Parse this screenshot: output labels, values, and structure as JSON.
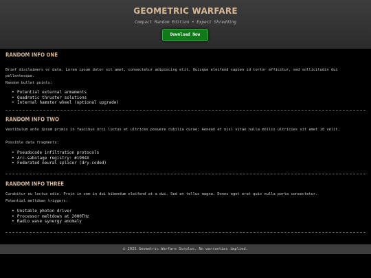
{
  "header": {
    "title": "GEOMETRIC WARFARE",
    "subtitle": "Compact Random Edition • Expect Shredding",
    "download_label": "Download Now"
  },
  "sections": [
    {
      "heading": "RANDOM INFO ONE",
      "body": "Brief disclaimers or data. Lorem ipsum dolor sit amet, consectetur adipiscing elit. Quisque eleifend sapien id tortor efficitur, sed sollicitudin dui pellentesque.",
      "caption": "Random bullet points:",
      "items": [
        "Potential external armaments",
        "Quadratic thruster solutions",
        "Internal hamster wheel (optional upgrade)"
      ]
    },
    {
      "heading": "RANDOM INFO TWO",
      "body": "Vestibulum ante ipsum primis in faucibus orci luctus et ultrices posuere cubilia curae; Aenean et nisl vitae nulla mollis ultricies sit amet id velit.",
      "caption": "Possible data fragments:",
      "items": [
        "Pseudocode infiltration protocols",
        "Arc-sabotage registry: #1904X",
        "Federated neural splicer (dry-coded)"
      ]
    },
    {
      "heading": "RANDOM INFO THREE",
      "body": "Curabitur eu lectus odio. Proin in sem in dui bibendum eleifend at a dui. Sed an tellus magna. Donec eget erat quis nulla porta consectetur.",
      "caption": "Potential meltdown triggers:",
      "items": [
        "Unstable photon driver",
        "Processor meltdown at 2000THz",
        "Radio wave synergy anomaly"
      ]
    }
  ],
  "footer": {
    "text": "© 2025 Geometric Warfare Surplus. No warranties implied."
  },
  "colors": {
    "heading_accent": "#d8b894",
    "button_green": "#0f7a17",
    "header_bg": "#333333",
    "page_bg": "#000000"
  }
}
